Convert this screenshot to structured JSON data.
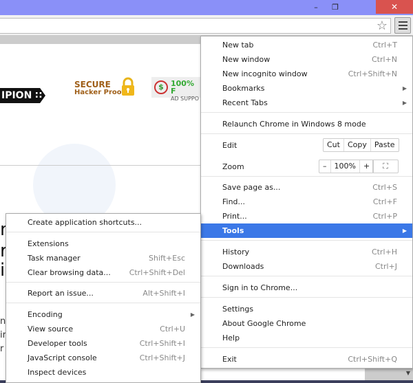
{
  "window": {
    "minimize": "–",
    "maximize": "❐",
    "close": "✕"
  },
  "toolbar": {
    "star_icon": "☆"
  },
  "page": {
    "champion_text": "IPION ∷",
    "secure_title": "SECURE",
    "secure_sub": "Hacker Proof",
    "ad_icon": "$",
    "ad_title": "100% F",
    "ad_sub": "AD SUPPO",
    "big_lines": [
      "n",
      "r",
      "i"
    ],
    "small_lines": [
      "n",
      "ir",
      "r"
    ]
  },
  "main_menu": {
    "items": [
      {
        "label": "New tab",
        "shortcut": "Ctrl+T"
      },
      {
        "label": "New window",
        "shortcut": "Ctrl+N"
      },
      {
        "label": "New incognito window",
        "shortcut": "Ctrl+Shift+N"
      },
      {
        "label": "Bookmarks",
        "submenu": "▶"
      },
      {
        "label": "Recent Tabs",
        "submenu": "▶"
      },
      {
        "label": "Relaunch Chrome in Windows 8 mode"
      },
      {
        "label": "Edit"
      },
      {
        "label": "Zoom"
      },
      {
        "label": "Save page as...",
        "shortcut": "Ctrl+S"
      },
      {
        "label": "Find...",
        "shortcut": "Ctrl+F"
      },
      {
        "label": "Print...",
        "shortcut": "Ctrl+P"
      },
      {
        "label": "Tools",
        "submenu": "▶"
      },
      {
        "label": "History",
        "shortcut": "Ctrl+H"
      },
      {
        "label": "Downloads",
        "shortcut": "Ctrl+J"
      },
      {
        "label": "Sign in to Chrome..."
      },
      {
        "label": "Settings"
      },
      {
        "label": "About Google Chrome"
      },
      {
        "label": "Help"
      },
      {
        "label": "Exit",
        "shortcut": "Ctrl+Shift+Q"
      }
    ],
    "edit": {
      "cut": "Cut",
      "copy": "Copy",
      "paste": "Paste"
    },
    "zoom": {
      "minus": "–",
      "value": "100%",
      "plus": "+",
      "fullscreen": "⛶"
    }
  },
  "tools_menu": {
    "items": [
      {
        "label": "Create application shortcuts..."
      },
      {
        "label": "Extensions"
      },
      {
        "label": "Task manager",
        "shortcut": "Shift+Esc"
      },
      {
        "label": "Clear browsing data...",
        "shortcut": "Ctrl+Shift+Del"
      },
      {
        "label": "Report an issue...",
        "shortcut": "Alt+Shift+I"
      },
      {
        "label": "Encoding",
        "submenu": "▶"
      },
      {
        "label": "View source",
        "shortcut": "Ctrl+U"
      },
      {
        "label": "Developer tools",
        "shortcut": "Ctrl+Shift+I"
      },
      {
        "label": "JavaScript console",
        "shortcut": "Ctrl+Shift+J"
      },
      {
        "label": "Inspect devices"
      }
    ]
  },
  "colors": {
    "titlebar": "#8a90f8",
    "close": "#d9534f",
    "highlight": "#3b78e7"
  },
  "bottom": {
    "dropdown_icon": "▼"
  }
}
